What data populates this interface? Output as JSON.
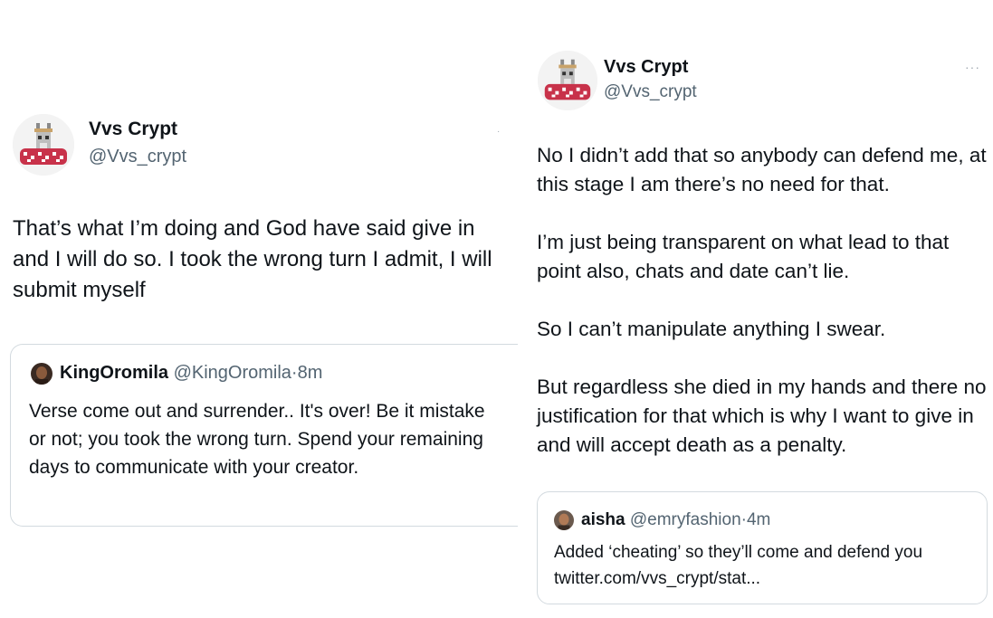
{
  "left_tweet": {
    "author_name": "Vvs Crypt",
    "author_handle": "@Vvs_crypt",
    "text": "That’s what I’m doing and God have said give in and I will do so. I took the wrong turn I admit, I will submit myself",
    "quote": {
      "author_name": "KingOromila",
      "author_handle": "@KingOromila",
      "separator": "·",
      "time": "8m",
      "text": "Verse come out and surrender.. It's over! Be it mistake or not; you took the wrong turn. Spend your remaining days to communicate with your creator."
    }
  },
  "right_tweet": {
    "author_name": "Vvs Crypt",
    "author_handle": "@Vvs_crypt",
    "more_label": "···",
    "paragraphs": [
      "No I didn’t add that so anybody can defend me, at this stage I am there’s no need for that.",
      "I’m just being transparent on what lead to that point also, chats and date can’t lie.",
      "So I can’t manipulate anything I swear.",
      "But regardless she died in my hands and there no justification for that which is why I want to give in and will accept death as a penalty."
    ],
    "quote": {
      "author_name": "aisha",
      "author_handle": "@emryfashion",
      "separator": "·",
      "time": "4m",
      "text": "Added ‘cheating’ so they’ll come and defend you twitter.com/vvs_crypt/stat..."
    }
  },
  "colors": {
    "text": "#0f1419",
    "secondary": "#536471",
    "border": "#d3dadf",
    "avatar_bowl": "#c8324a"
  },
  "icons": {
    "avatar": "pixel-goat-in-red-bowl-avatar",
    "more": "more-dots-icon"
  }
}
